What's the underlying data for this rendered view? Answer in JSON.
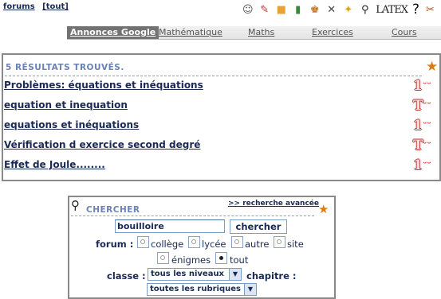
{
  "topbar": {
    "links": [
      "forums",
      "[tout]"
    ],
    "icons": [
      "user-icon",
      "tag-icon",
      "bookmark-icon",
      "stats-icon",
      "profile-icon",
      "connect-icon",
      "star-icon",
      "search-icon",
      "latex-icon",
      "help-icon",
      "tools-icon"
    ],
    "latex_label": "LATEX",
    "help_label": "?"
  },
  "nav": {
    "tabs": [
      "Annonces Google",
      "Mathématique",
      "Maths",
      "Exercices",
      "Cours"
    ],
    "active_index": 0
  },
  "results": {
    "heading": "5 RÉSULTATS TROUVÉS.",
    "items": [
      {
        "title": "Problèmes: équations et inéquations",
        "badge": "1"
      },
      {
        "title": "equation et inequation",
        "badge": "T"
      },
      {
        "title": "equations et inéquations",
        "badge": "1"
      },
      {
        "title": "Vérification d exercice second degré",
        "badge": "T"
      },
      {
        "title": "Effet de Joule........",
        "badge": "1"
      }
    ]
  },
  "search": {
    "title": "CHERCHER",
    "advanced_link": ">> recherche avancée",
    "query": "bouilloire",
    "button": "chercher",
    "forum_label": "forum :",
    "forum_options": [
      "collège",
      "lycée",
      "autre",
      "site",
      "énigmes",
      "tout"
    ],
    "forum_selected": "tout",
    "classe_label": "classe :",
    "classe_value": "tous les niveaux",
    "chapitre_label": "chapitre :",
    "chapitre_value": "toutes les rubriques"
  },
  "colors": {
    "accent": "#1b2a55",
    "heading": "#6a82b6",
    "star": "#e07a10",
    "badge": "#b33333"
  }
}
